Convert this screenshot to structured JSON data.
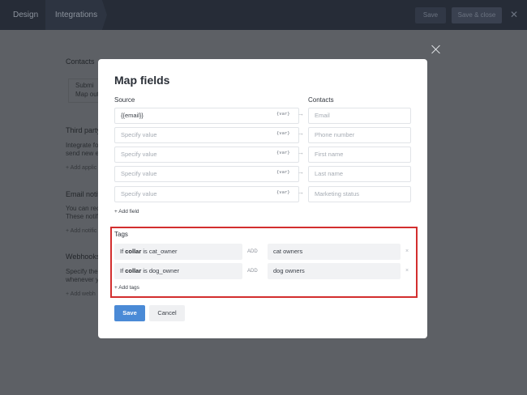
{
  "topbar": {
    "tabs": [
      "Design",
      "Integrations"
    ],
    "save_label": "Save",
    "save_close_label": "Save & close",
    "close_glyph": "✕"
  },
  "background": {
    "contacts_title": "Contacts",
    "submit_line1": "Submi",
    "submit_line2": "Map out",
    "third_party_title": "Third party",
    "third_party_line1": "Integrate fo",
    "third_party_line2": "send new en",
    "add_application": "+ Add applic",
    "email_notif_title": "Email notifi",
    "email_notif_line1": "You can rece",
    "email_notif_line2": "These notific",
    "add_notification": "+ Add notific",
    "webhooks_title": "Webhooks",
    "webhooks_line1": "Specify the",
    "webhooks_line2": "whenever yo",
    "add_webhook": "+ Add webh"
  },
  "modal": {
    "title": "Map fields",
    "source_label": "Source",
    "contacts_label": "Contacts",
    "var_badge": "{var}",
    "arrow": "→",
    "rows": [
      {
        "source": "{{email}}",
        "source_placeholder": false,
        "target": "Email"
      },
      {
        "source": "Specify value",
        "source_placeholder": true,
        "target": "Phone number"
      },
      {
        "source": "Specify value",
        "source_placeholder": true,
        "target": "First name"
      },
      {
        "source": "Specify value",
        "source_placeholder": true,
        "target": "Last name"
      },
      {
        "source": "Specify value",
        "source_placeholder": true,
        "target": "Marketing status"
      }
    ],
    "add_field": "+ Add field",
    "tags_label": "Tags",
    "tags": [
      {
        "prefix": "If",
        "field": "collar",
        "op": "is",
        "value": "cat_owner",
        "add_word": "ADD",
        "tag": "cat owners"
      },
      {
        "prefix": "If",
        "field": "collar",
        "op": "is",
        "value": "dog_owner",
        "add_word": "ADD",
        "tag": "dog owners"
      }
    ],
    "remove_glyph": "×",
    "add_tags": "+ Add tags",
    "save_label": "Save",
    "cancel_label": "Cancel"
  },
  "colors": {
    "primary": "#4a8ad6",
    "highlight_border": "#d32f2f"
  }
}
